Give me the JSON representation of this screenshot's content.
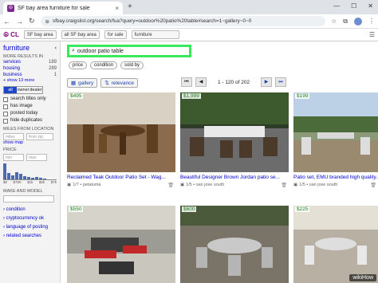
{
  "browser": {
    "tab_title": "SF bay area furniture for sale",
    "url": "sfbay.craigslist.org/search/fua?query=outdoor%20patio%20table#search=1~gallery~0~0"
  },
  "cl_header": {
    "logo": "CL",
    "area": "SF bay area",
    "subarea": "all SF bay area",
    "section": "for sale",
    "category": "furniture"
  },
  "sidebar": {
    "title": "furniture",
    "more_results_label": "MORE RESULTS IN",
    "more_results": [
      {
        "label": "services",
        "count": "189"
      },
      {
        "label": "housing",
        "count": "289"
      },
      {
        "label": "business",
        "count": "1"
      }
    ],
    "show_more": "+ show 13 more",
    "owner_filter": [
      "all",
      "owner",
      "dealer"
    ],
    "checkboxes": [
      "search titles only",
      "has image",
      "posted today",
      "hide duplicates"
    ],
    "miles_label": "MILES FROM LOCATION",
    "miles_placeholder": "miles",
    "zip_placeholder": "from zip",
    "show_map": "show map",
    "price_label": "PRICE",
    "price_min": "min",
    "price_max": "max",
    "hist_values": [
      22,
      9,
      6,
      10,
      8,
      4,
      3,
      2,
      3,
      2,
      1
    ],
    "hist_labels": [
      "$0",
      "$750",
      "$1k",
      "$2k",
      "$7k"
    ],
    "make_model_label": "MAKE AND MODEL",
    "links": [
      "condition",
      "cryptocurrency ok",
      "language of posting",
      "related searches"
    ]
  },
  "search": {
    "query": "outdoor patio table"
  },
  "pills": [
    "price",
    "condition",
    "sold by"
  ],
  "controls": {
    "view": "gallery",
    "sort": "relevance",
    "range": "1 - 120 of 202"
  },
  "listings": [
    {
      "price": "$495",
      "title": "Reclaimed Teak Outdoor Patio Set - Wag...",
      "meta": "1/7 • petaluma"
    },
    {
      "price": "$1,999",
      "title": "Beautiful Designer Brown Jordan patio se...",
      "meta": "1/5 • san jose south"
    },
    {
      "price": "$199",
      "title": "Patio set, EMU branded high quality...",
      "meta": "1/5 • san jose south"
    },
    {
      "price": "$550",
      "title": "",
      "meta": ""
    },
    {
      "price": "$600",
      "title": "",
      "meta": ""
    },
    {
      "price": "$225",
      "title": "",
      "meta": ""
    }
  ],
  "watermark": "wikiHow"
}
